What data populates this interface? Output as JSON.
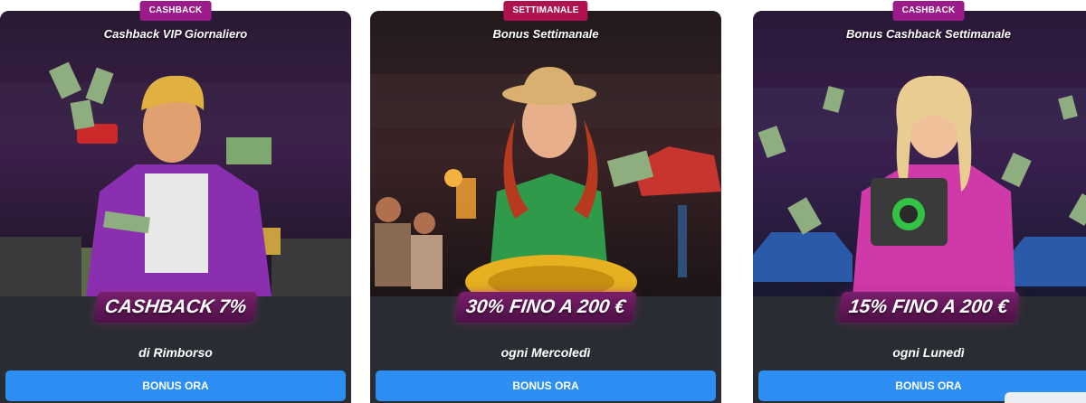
{
  "cards": [
    {
      "tag": "CASHBACK",
      "title": "Cashback VIP Giornaliero",
      "amount": "CASHBACK 7%",
      "subtitle": "di Rimborso",
      "button": "BONUS ORA",
      "tag_color": "#9b1b8a"
    },
    {
      "tag": "SETTIMANALE",
      "title": "Bonus Settimanale",
      "amount": "30% FINO A 200 €",
      "subtitle": "ogni Mercoledì",
      "button": "BONUS ORA",
      "tag_color": "#b0124f"
    },
    {
      "tag": "CASHBACK",
      "title": "Bonus Cashback Settimanale",
      "amount": "15% FINO A 200 €",
      "subtitle": "ogni Lunedì",
      "button": "BONUS ORA",
      "tag_color": "#9b1b8a"
    }
  ],
  "colors": {
    "card_bg": "#2a2c33",
    "button": "#2d8ff4",
    "amount_badge": "#6a1a60"
  }
}
